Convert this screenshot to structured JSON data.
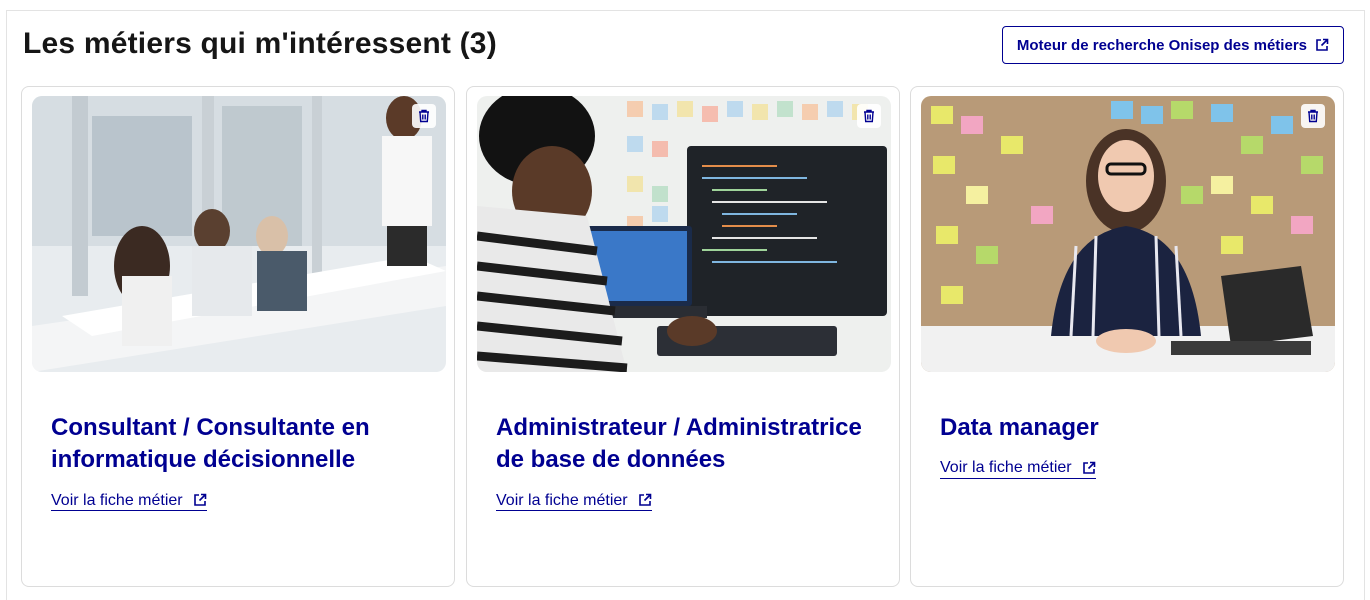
{
  "section": {
    "title": "Les métiers qui m'intéressent (3)",
    "search_button_label": "Moteur de recherche Onisep des métiers"
  },
  "accent_color": "#000091",
  "cards": [
    {
      "title": "Consultant / Consultante en informatique décisionnelle",
      "link_label": "Voir la fiche métier",
      "image_description_icon": "meeting-photo"
    },
    {
      "title": "Administrateur / Administratrice de base de données",
      "link_label": "Voir la fiche métier",
      "image_description_icon": "developer-photo"
    },
    {
      "title": "Data manager",
      "link_label": "Voir la fiche métier",
      "image_description_icon": "data-manager-photo"
    }
  ],
  "icons": {
    "delete": "trash-icon",
    "external": "external-link-icon"
  }
}
